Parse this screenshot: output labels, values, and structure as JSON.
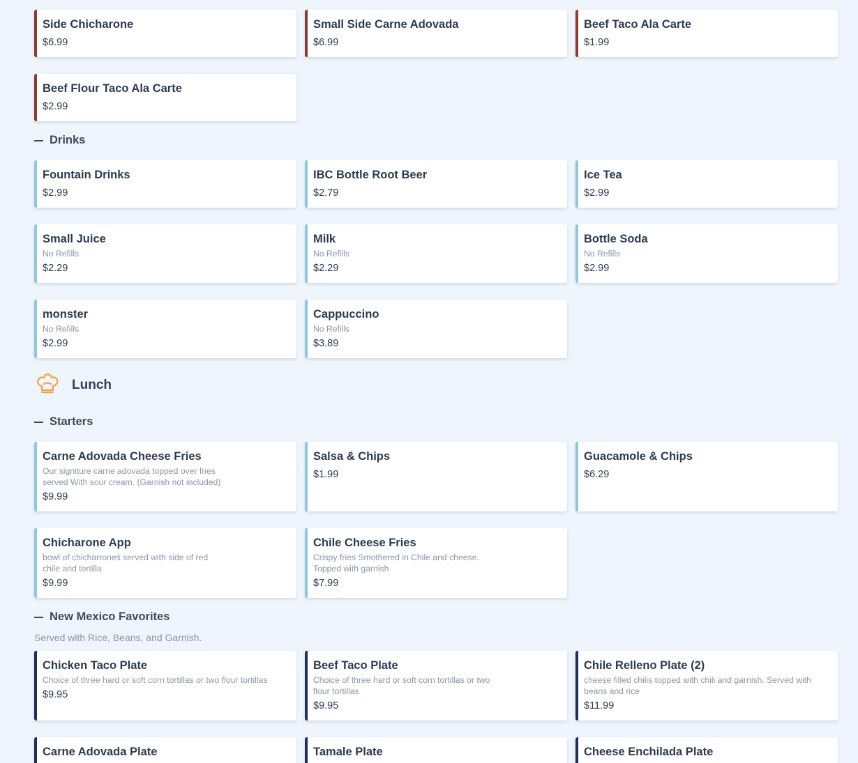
{
  "sides": [
    {
      "name": "Side Chicharone",
      "price": "$6.99"
    },
    {
      "name": "Small Side Carne Adovada",
      "price": "$6.99"
    },
    {
      "name": "Beef Taco Ala Carte",
      "price": "$1.99"
    },
    {
      "name": "Beef Flour Taco Ala Carte",
      "price": "$2.99"
    }
  ],
  "drinks": {
    "title": "Drinks",
    "items": [
      {
        "name": "Fountain Drinks",
        "price": "$2.99"
      },
      {
        "name": "IBC Bottle Root Beer",
        "price": "$2.79"
      },
      {
        "name": "Ice Tea",
        "price": "$2.99"
      },
      {
        "name": "Small Juice",
        "desc": "No Refills",
        "price": "$2.29"
      },
      {
        "name": "Milk",
        "desc": "No Refills",
        "price": "$2.29"
      },
      {
        "name": "Bottle Soda",
        "desc": "No Refills",
        "price": "$2.99"
      },
      {
        "name": "monster",
        "desc": "No Refills",
        "price": "$2.99"
      },
      {
        "name": "Cappuccino",
        "desc": "No Refills",
        "price": "$3.89"
      }
    ]
  },
  "lunch": {
    "title": "Lunch",
    "icon": "chef-hat-icon",
    "icon_color": "#f0a441"
  },
  "starters": {
    "title": "Starters",
    "items": [
      {
        "name": "Carne Adovada Cheese Fries",
        "desc": "Our signiture carne adovada topped over fries served With sour cream. (Garnish not included)",
        "price": "$9.99"
      },
      {
        "name": "Salsa & Chips",
        "price": "$1.99"
      },
      {
        "name": "Guacamole & Chips",
        "price": "$6.29"
      },
      {
        "name": "Chicharone App",
        "desc": "bowl of chicharrones served with side of red chile and tortilla",
        "price": "$9.99"
      },
      {
        "name": "Chile Cheese Fries",
        "desc": "Crispy fries Smothered in Chile and cheese. Topped with garnish",
        "price": "$7.99"
      }
    ]
  },
  "nm_favorites": {
    "title": "New Mexico Favorites",
    "note": "Served with Rice, Beans, and Garnish.",
    "items": [
      {
        "name": "Chicken Taco Plate",
        "desc": "Choice of three hard or soft corn tortillas or two flour tortillas",
        "price": "$9.95"
      },
      {
        "name": "Beef Taco Plate",
        "desc": "Choice of three hard or soft corn tortillas or two flour tortillas",
        "price": "$9.95"
      },
      {
        "name": "Chile Relleno Plate (2)",
        "desc": "cheese filled chilis topped with chili and garnish. Served with beans and rice",
        "price": "$11.99"
      },
      {
        "name": "Carne Adovada Plate"
      },
      {
        "name": "Tamale Plate"
      },
      {
        "name": "Cheese Enchilada Plate"
      }
    ]
  },
  "colors": {
    "side_accent": "#8b3b33",
    "drink_accent": "#8fc8dc",
    "nm_accent": "#1e2f5e",
    "background": "#eff5fc"
  }
}
